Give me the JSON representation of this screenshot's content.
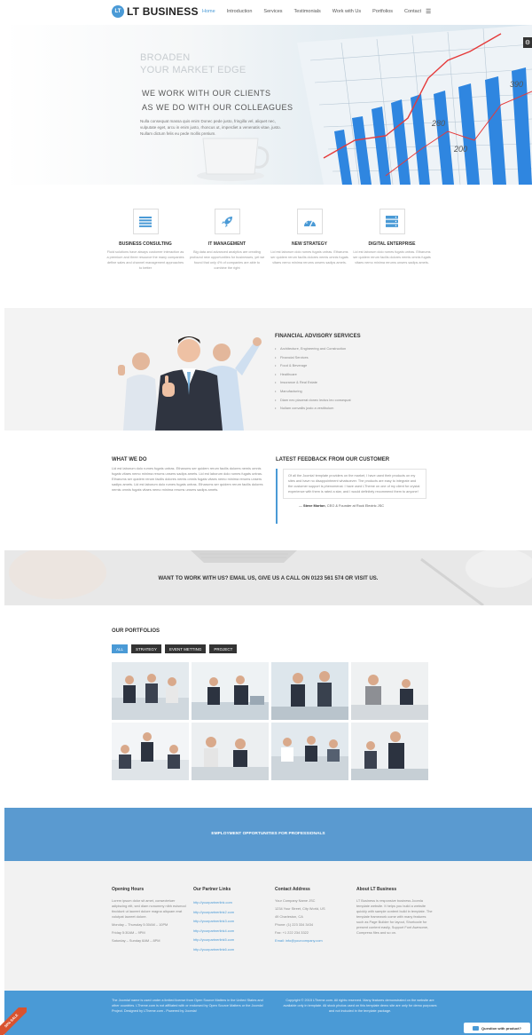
{
  "header": {
    "logo_mark": "LT",
    "logo_text": "LT BUSINESS",
    "nav": [
      "Home",
      "Introduction",
      "Services",
      "Testimonials",
      "Work with Us",
      "Portfolios",
      "Contact"
    ],
    "active_nav": "Home",
    "menu_icon": "hamburger-icon"
  },
  "hero": {
    "line1": "BROADEN",
    "line2": "YOUR MARKET EDGE",
    "line3": "WE WORK WITH OUR CLIENTS",
    "line4": "AS WE DO WITH OUR COLLEAGUES",
    "paragraph": "Nulla consequat massa quis enim Donec pede justo, fringilla vel, aliquet nec, vulputate eget, arcu in enim justo, rhoncus ut, imperdiet a venenatis vitae, justo. Nullam dictum felis eu pede mollis pretium.",
    "chart_labels": [
      "390",
      "280",
      "200"
    ],
    "settings_icon": "gear-icon"
  },
  "services": [
    {
      "title": "BUSINESS CONSULTING",
      "desc": "Fluid solutions have always customer interaction as a premium and three resource the many companies define sales and channel management approaches to better",
      "icon": "bars-icon"
    },
    {
      "title": "IT MANAGEMENT",
      "desc": "Big data and advanced analytics are creating profound new opportunities for businesses, yet we found that only 4% of companies are able to combine the right",
      "icon": "rocket-icon"
    },
    {
      "title": "NEW STRATEGY",
      "desc": "Lid est laborum dolo rumes fugats untras. Etharums ser quidem rerum facilis dolores nemis omnis fugats vitaes nemo minima rerums unsers sadips amets.",
      "icon": "dashboard-icon"
    },
    {
      "title": "DIGITAL ENTERPRISE",
      "desc": "Lid est laborum dolo rumes fugats untras. Etharums ser quidem rerum facilis dolores nemis omnis fugats vitaes nemo minima rerums unsers sadips amets.",
      "icon": "server-icon"
    }
  ],
  "financial": {
    "title": "FINANCIAL ADVISORY SERVICES",
    "items": [
      "Architecture, Engineering and Construction",
      "Financial Services",
      "Food & Beverage",
      "Healthcare",
      "Insurance & Real Estate",
      "Manufacturing",
      "Diam nec placerat donec lectus leo consequat",
      "Nullam convallis justo a vestibulum"
    ]
  },
  "what_we_do": {
    "title": "WHAT WE DO",
    "text": "Lid est laborum dolo rumes fugats untras. Etharums ser quidem rerum facilis dolores nemis omnis fugats vitaes nemo minima rerums unsers sadips amets. Lid est laborum dolo rumes fugats untras. Etharums ser quidem rerum facilis dolores nemis omnis fugats vitaes nemo minima rerums unsers sadips amets. Lid est laborum dolo rumes fugats untras. Etharums ser quidem rerum facilis dolores nemis omnis fugats vitaes nemo minima rerums unsers sadips amets."
  },
  "feedback": {
    "title": "LATEST FEEDBACK FROM OUR CUSTOMER",
    "quote": "Of all the Joomla! template providers on the market, I have used their products on my sites and have no disappointment whatsoever. The products are easy to integrate and the customer support is phenomenal. I have used LTheme on one of my client for crystal experience with them is rated a star, and I would definitely recommend them to anyone!",
    "author_name": "Steve Morton",
    "author_role": ", CEO & Founder at Rock Electric JSC"
  },
  "cta": {
    "text": "WANT TO WORK WITH US? EMAIL US, GIVE US A CALL ON 0123 561 574 OR VISIT US."
  },
  "portfolios": {
    "title": "OUR PORTFOLIOS",
    "filters": [
      "ALL",
      "STRATEGY",
      "EVENT METTING",
      "PROJECT"
    ],
    "active_filter": "ALL"
  },
  "employment": {
    "text": "EMPLOYMENT OPPORTUNITIES FOR PROFESSIONALS"
  },
  "footer": {
    "hours": {
      "title": "Opening Hours",
      "intro": "Lorem ipsum dolor sit amet, consectetuer adipiscing elit, sed diam nonummy nibh euismod tincidunt ut laoreet dolore magna aliquam erat volutpat laoreet dolore.",
      "weekdays": "Monday – Thursday 5:30AM – 10PM",
      "friday": "Friday 5:30AM – 9PM",
      "weekend": "Saturday – Sunday 8AM – 8PM"
    },
    "partners": {
      "title": "Our Partner Links",
      "links": [
        "http://yourpartnerlink.com",
        "http://yourpartnerlink2.com",
        "http://yourpartnerlink3.com",
        "http://yourpartnerlink4.com",
        "http://yourpartnerlink5.com",
        "http://yourpartnerlink6.com"
      ]
    },
    "contact": {
      "title": "Contact Address",
      "company": "Your Company Name JSC",
      "street": "1234 Your Street, City World, US",
      "city": "49 Charleston, CA",
      "phone": "Phone: (1) 223 334 3434",
      "fax": "Fax: +1 222 234 3322",
      "email": "Email: info@yourcompany.com"
    },
    "about": {
      "title": "About LT Business",
      "text": "LT Business is responsive business Joomla template website. It helps you build a website quickly with sample content build in template. The template framework come with many features such as Page Builder for layout, Shortcode for present content easily, Support Font Awesome, Compress files and so on."
    }
  },
  "bottom": {
    "left": "The Joomla! name is used under a limited license from Open Source Matters in the United States and other countries. LTheme.com is not affiliated with or endorsed by Open Source Matters or the Joomla! Project. Designed by LTheme.com - Powered by Joomla!",
    "right": "Copyright © 2015 LTheme.com. All rights reserved. Many features demonstrated on the website are available only in template. All stock photos used on this template demo site are only for demo purposes and not included in the template package.",
    "badge": "50% SALE",
    "chat_label": "Question with product?"
  }
}
